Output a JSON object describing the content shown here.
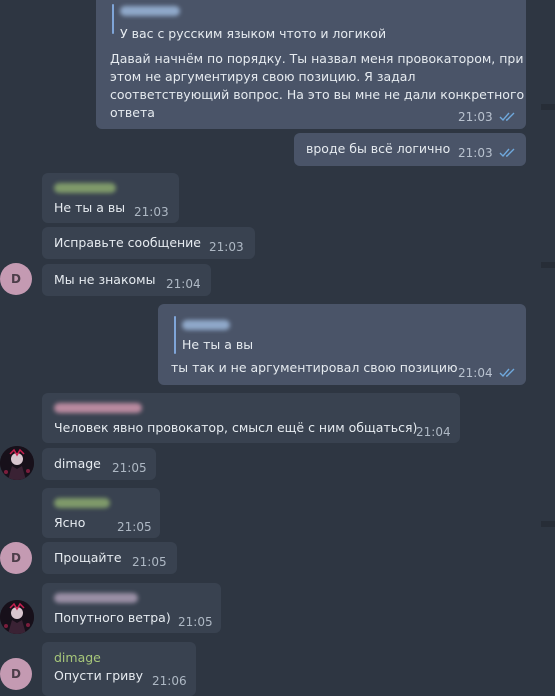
{
  "theme": {
    "background": "#2e3642",
    "incoming_bubble": "#394250",
    "outgoing_bubble": "#4a5468",
    "read_check": "#6fa8dc",
    "sender_name_color": "#a7c77a"
  },
  "messages": [
    {
      "direction": "outgoing",
      "reply": {
        "sender": "dimage",
        "text": "У вас с русским языком чтото и логикой"
      },
      "lines": [
        "Давай начнём по порядку. Ты назвал меня провокатором, при",
        "этом не аргументируя свою позицию. Я задал",
        "соответствующий вопрос. На это вы мне не дали конкретного",
        "ответа"
      ],
      "time": "21:03",
      "status_icon": "double-check-icon"
    },
    {
      "direction": "outgoing",
      "text": "вроде бы всё логично",
      "time": "21:03",
      "status_icon": "double-check-icon"
    },
    {
      "direction": "incoming",
      "sender": "dimage",
      "text": "Не ты а вы",
      "time": "21:03"
    },
    {
      "direction": "incoming",
      "text": "Исправьте сообщение",
      "time": "21:03"
    },
    {
      "direction": "incoming",
      "avatar_letter": "D",
      "text": "Мы не знакомы",
      "time": "21:04"
    },
    {
      "direction": "outgoing",
      "reply": {
        "sender": "dimage",
        "text": "Не ты а вы"
      },
      "text": "ты так и не аргументировал свою позицию",
      "time": "21:04",
      "status_icon": "double-check-icon"
    },
    {
      "direction": "incoming",
      "text": "Человек явно провокатор, смысл ещё с ним общаться)",
      "time": "21:04"
    },
    {
      "direction": "incoming",
      "avatar": "profile-photo",
      "text": "dimage",
      "time": "21:05"
    },
    {
      "direction": "incoming",
      "text": "Ясно",
      "time": "21:05"
    },
    {
      "direction": "incoming",
      "avatar_letter": "D",
      "text": "Прощайте",
      "time": "21:05"
    },
    {
      "direction": "incoming",
      "avatar": "profile-photo",
      "text": "Попутного ветра)",
      "time": "21:05"
    },
    {
      "direction": "incoming",
      "avatar_letter": "D",
      "sender": "dimage",
      "text": "Опусти гриву",
      "time": "21:06"
    }
  ]
}
